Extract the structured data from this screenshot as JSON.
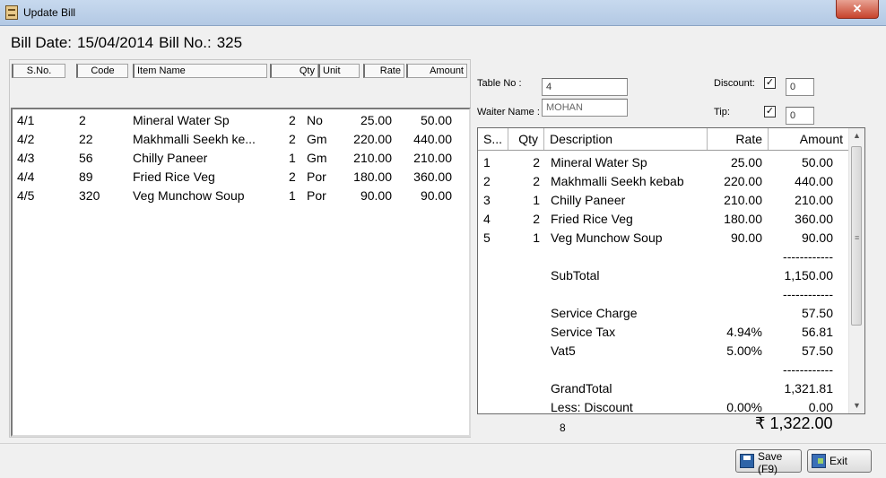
{
  "window": {
    "title": "Update Bill",
    "close_glyph": "✕"
  },
  "header": {
    "bill_date_label": "Bill Date:",
    "bill_date": "15/04/2014",
    "bill_no_label": "Bill No.:",
    "bill_no": "325"
  },
  "left_table": {
    "columns": [
      "S.No.",
      "Code",
      "Item Name",
      "Qty",
      "Unit",
      "Rate",
      "Amount"
    ],
    "rows": [
      {
        "sno": "4/1",
        "code": "2",
        "name": "Mineral Water Sp",
        "qty": "2",
        "unit": "No",
        "rate": "25.00",
        "amount": "50.00"
      },
      {
        "sno": "4/2",
        "code": "22",
        "name": "Makhmalli Seekh ke...",
        "qty": "2",
        "unit": "Gm",
        "rate": "220.00",
        "amount": "440.00"
      },
      {
        "sno": "4/3",
        "code": "56",
        "name": "Chilly Paneer",
        "qty": "1",
        "unit": "Gm",
        "rate": "210.00",
        "amount": "210.00"
      },
      {
        "sno": "4/4",
        "code": "89",
        "name": "Fried Rice Veg",
        "qty": "2",
        "unit": "Por",
        "rate": "180.00",
        "amount": "360.00"
      },
      {
        "sno": "4/5",
        "code": "320",
        "name": "Veg Munchow Soup",
        "qty": "1",
        "unit": "Por",
        "rate": "90.00",
        "amount": "90.00"
      }
    ]
  },
  "form": {
    "table_no_label": "Table No :",
    "table_no": "4",
    "waiter_label": "Waiter Name :",
    "waiter": "MOHAN",
    "discount_label": "Discount:",
    "discount_checked": "✓",
    "discount_value": "0",
    "tip_label": "Tip:",
    "tip_checked": "✓",
    "tip_value": "0"
  },
  "bill_grid": {
    "columns": [
      "S...",
      "Qty",
      "Description",
      "Rate",
      "Amount"
    ],
    "rows": [
      {
        "s": "1",
        "qty": "2",
        "desc": "Mineral Water Sp",
        "rate": "25.00",
        "amount": "50.00"
      },
      {
        "s": "2",
        "qty": "2",
        "desc": "Makhmalli Seekh kebab",
        "rate": "220.00",
        "amount": "440.00"
      },
      {
        "s": "3",
        "qty": "1",
        "desc": "Chilly Paneer",
        "rate": "210.00",
        "amount": "210.00"
      },
      {
        "s": "4",
        "qty": "2",
        "desc": "Fried Rice Veg",
        "rate": "180.00",
        "amount": "360.00"
      },
      {
        "s": "5",
        "qty": "1",
        "desc": "Veg Munchow Soup",
        "rate": "90.00",
        "amount": "90.00"
      },
      {
        "s": "",
        "qty": "",
        "desc": "",
        "rate": "",
        "amount": "------------"
      },
      {
        "s": "",
        "qty": "",
        "desc": "SubTotal",
        "rate": "",
        "amount": "1,150.00"
      },
      {
        "s": "",
        "qty": "",
        "desc": "",
        "rate": "",
        "amount": "------------"
      },
      {
        "s": "",
        "qty": "",
        "desc": "Service Charge",
        "rate": "",
        "amount": "57.50"
      },
      {
        "s": "",
        "qty": "",
        "desc": "Service Tax",
        "rate": "4.94%",
        "amount": "56.81"
      },
      {
        "s": "",
        "qty": "",
        "desc": "Vat5",
        "rate": "5.00%",
        "amount": "57.50"
      },
      {
        "s": "",
        "qty": "",
        "desc": "",
        "rate": "",
        "amount": "------------"
      },
      {
        "s": "",
        "qty": "",
        "desc": "GrandTotal",
        "rate": "",
        "amount": "1,321.81"
      },
      {
        "s": "",
        "qty": "",
        "desc": "Less: Discount",
        "rate": "0.00%",
        "amount": "0.00"
      }
    ]
  },
  "footer": {
    "item_count": "8",
    "total": "₹ 1,322.00",
    "save_label": "Save (F9)",
    "exit_label": "Exit"
  },
  "icons": {
    "scroll_up": "▲",
    "scroll_down": "▼",
    "scroll_grip": "≡"
  }
}
